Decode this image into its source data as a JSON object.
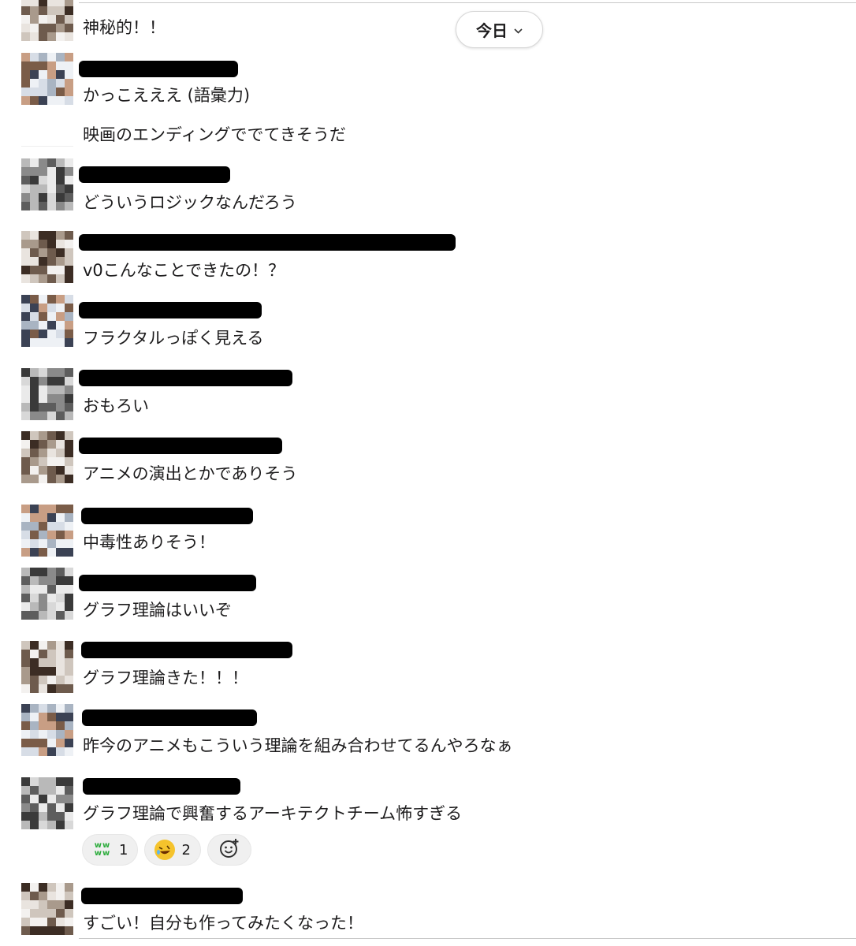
{
  "date_divider": {
    "label": "今日",
    "icon": "chevron-down-icon"
  },
  "messages": [
    {
      "text": "神秘的！！"
    },
    {
      "text": "かっこえええ (語彙力)"
    },
    {
      "text": "映画のエンディングででてきそうだ"
    },
    {
      "text": "どういうロジックなんだろう"
    },
    {
      "text": "v0こんなことできたの！？"
    },
    {
      "text": "フラクタルっぽく見える"
    },
    {
      "text": "おもろい"
    },
    {
      "text": "アニメの演出とかでありそう"
    },
    {
      "text": "中毒性ありそう！"
    },
    {
      "text": "グラフ理論はいいぞ"
    },
    {
      "text": "グラフ理論きた！！！"
    },
    {
      "text": "昨今のアニメもこういう理論を組み合わせてるんやろなぁ"
    },
    {
      "text": "グラフ理論で興奮するアーキテクトチーム怖すぎる"
    },
    {
      "text": "すごい！自分も作ってみたくなった！"
    }
  ],
  "reactions": [
    {
      "icon": "www-emoji-icon",
      "glyph": "ww ww",
      "count": "1"
    },
    {
      "icon": "rolling-laughing-emoji-icon",
      "glyph": "",
      "count": "2"
    }
  ],
  "colors": {
    "accent_green": "#2bac3b",
    "pill_bg": "#f0f0f0",
    "redaction": "#000000"
  }
}
